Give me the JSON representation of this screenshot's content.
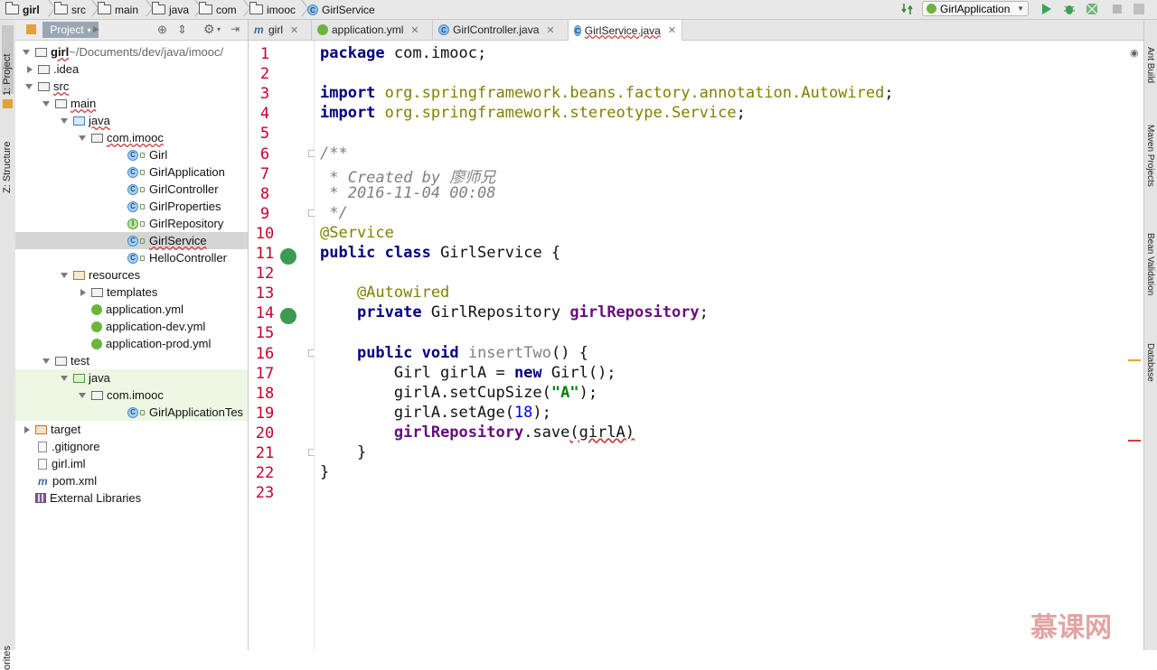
{
  "breadcrumbs": [
    "girl",
    "src",
    "main",
    "java",
    "com",
    "imooc",
    "GirlService"
  ],
  "toolbar": {
    "run_config": "GirlApplication",
    "icons": [
      "build-icon",
      "run-icon",
      "debug-icon",
      "coverage-icon",
      "stop-icon"
    ]
  },
  "left_tabs": [
    "1: Project",
    "Z: Structure",
    "orites"
  ],
  "project_panel": {
    "tab_label": "Project",
    "tree": [
      {
        "label": "girl",
        "suffix": " ~/Documents/dev/java/imooc/",
        "indent": 0,
        "arrow": "down",
        "icon": "folder"
      },
      {
        "label": ".idea",
        "indent": 1,
        "arrow": "right",
        "icon": "folder"
      },
      {
        "label": "src",
        "indent": 1,
        "arrow": "down",
        "icon": "folder"
      },
      {
        "label": "main",
        "indent": 2,
        "arrow": "down",
        "icon": "folder"
      },
      {
        "label": "java",
        "indent": 3,
        "arrow": "down",
        "icon": "folder-blue"
      },
      {
        "label": "com.imooc",
        "indent": 4,
        "arrow": "down",
        "icon": "package"
      },
      {
        "label": "Girl",
        "indent": 5,
        "icon": "class"
      },
      {
        "label": "GirlApplication",
        "indent": 5,
        "icon": "class-spring"
      },
      {
        "label": "GirlController",
        "indent": 5,
        "icon": "class"
      },
      {
        "label": "GirlProperties",
        "indent": 5,
        "icon": "class"
      },
      {
        "label": "GirlRepository",
        "indent": 5,
        "icon": "interface"
      },
      {
        "label": "GirlService",
        "indent": 5,
        "icon": "class",
        "selected": true
      },
      {
        "label": "HelloController",
        "indent": 5,
        "icon": "class"
      },
      {
        "label": "resources",
        "indent": 3,
        "arrow": "down",
        "icon": "folder-res"
      },
      {
        "label": "templates",
        "indent": 4,
        "arrow": "right",
        "icon": "folder"
      },
      {
        "label": "application.yml",
        "indent": 4,
        "icon": "yml"
      },
      {
        "label": "application-dev.yml",
        "indent": 4,
        "icon": "yml"
      },
      {
        "label": "application-prod.yml",
        "indent": 4,
        "icon": "yml"
      },
      {
        "label": "test",
        "indent": 2,
        "arrow": "down",
        "icon": "folder"
      },
      {
        "label": "java",
        "indent": 3,
        "arrow": "down",
        "icon": "folder-green",
        "test": true
      },
      {
        "label": "com.imooc",
        "indent": 4,
        "arrow": "down",
        "icon": "package",
        "test": true
      },
      {
        "label": "GirlApplicationTes",
        "indent": 5,
        "icon": "class-spring",
        "test": true
      },
      {
        "label": "target",
        "indent": 0,
        "arrow": "right",
        "icon": "folder-orange"
      },
      {
        "label": ".gitignore",
        "indent": 1,
        "icon": "file"
      },
      {
        "label": "girl.iml",
        "indent": 1,
        "icon": "file"
      },
      {
        "label": "pom.xml",
        "indent": 1,
        "icon": "maven"
      },
      {
        "label": "External Libraries",
        "indent": 0,
        "icon": "library"
      }
    ]
  },
  "editor_tabs": [
    {
      "label": "girl",
      "icon": "maven"
    },
    {
      "label": "application.yml",
      "icon": "yml"
    },
    {
      "label": "GirlController.java",
      "icon": "class"
    },
    {
      "label": "GirlService.java",
      "icon": "class",
      "active": true
    }
  ],
  "code": {
    "current_line": 20,
    "lines": [
      "package com.imooc;",
      "",
      "import org.springframework.beans.factory.annotation.Autowired;",
      "import org.springframework.stereotype.Service;",
      "",
      "/**",
      " * Created by 廖师兄",
      " * 2016-11-04 00:08",
      " */",
      "@Service",
      "public class GirlService {",
      "",
      "    @Autowired",
      "    private GirlRepository girlRepository;",
      "",
      "    public void insertTwo() {",
      "        Girl girlA = new Girl();",
      "        girlA.setCupSize(\"A\");",
      "        girlA.setAge(18);",
      "        girlRepository.save(girlA)",
      "    }",
      "}",
      ""
    ]
  },
  "right_tabs": [
    "Ant Build",
    "Maven Projects",
    "Bean Validation",
    "Database"
  ],
  "watermark": "慕课网",
  "colors": {
    "line_number": "#c7002a",
    "keyword": "#000080",
    "package": "#808000",
    "comment": "#808080",
    "field": "#660e7a",
    "string": "#008000",
    "number": "#0000ff"
  }
}
